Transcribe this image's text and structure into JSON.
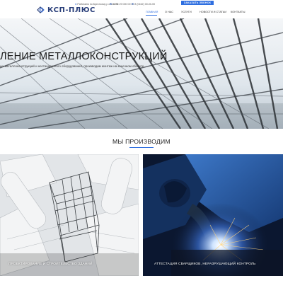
{
  "header": {
    "logo_text": "КСП-ПЛЮС",
    "region": "Работаем по Бресткому р области",
    "phone_1": "+375 29 000 00 00",
    "phone_2": "8 (0162) 00-00-00",
    "callback_label": "ЗАКАЗАТЬ ЗВОНОК",
    "nav": [
      "Главная",
      "О нас",
      "Услуги",
      "Новости и статьи",
      "Контакты"
    ],
    "active_nav": "Главная",
    "accent_color": "#2f6fe0"
  },
  "hero": {
    "title": "ЛЕНИЕ МЕТАЛЛОКОНСТРУКЦИЙ",
    "subtitle": "ых металлоконструкций и нестандартного оборудования, производим монтаж на конечном объекте"
  },
  "section": {
    "title": "МЫ ПРОИЗВОДИМ"
  },
  "cards": [
    {
      "caption": "ПРОЕКТИРОВАНИЕ И СТРОИТЕЛЬСТВО ЗДАНИЙ"
    },
    {
      "caption": "АТТЕСТАЦИЯ СВАРЩИКОВ, НЕРАЗРУШАЮЩИЙ КОНТРОЛЬ"
    }
  ]
}
